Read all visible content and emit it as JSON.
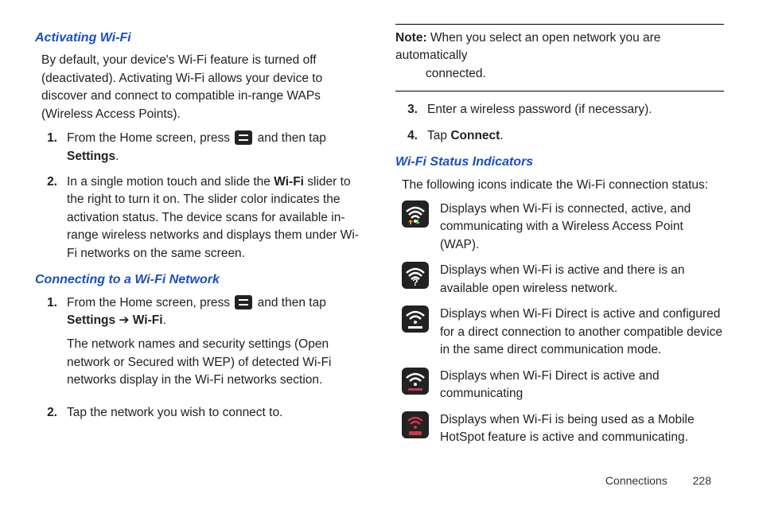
{
  "left": {
    "heading1": "Activating Wi-Fi",
    "intro1": "By default, your device's Wi-Fi feature is turned off (deactivated). Activating Wi-Fi allows your device to discover and connect to compatible in-range WAPs (Wireless Access Points).",
    "list1": {
      "item1_pre": "From the Home screen, press ",
      "item1_post": " and then tap ",
      "item1_bold": "Settings",
      "item1_end": ".",
      "item2_pre": "In a single motion touch and slide the ",
      "item2_bold": "Wi-Fi",
      "item2_post": " slider to the right to turn it on. The slider color indicates the activation status. The device scans for available in-range wireless networks and displays them under Wi-Fi networks on the same screen."
    },
    "heading2": "Connecting to a Wi-Fi Network",
    "list2": {
      "item1_pre": "From the Home screen, press ",
      "item1_post": " and then tap ",
      "item1_bold1": "Settings",
      "item1_arrow": " ➔ ",
      "item1_bold2": "Wi-Fi",
      "item1_end": ".",
      "item1_para2": "The network names and security settings (Open network or Secured with WEP) of detected Wi-Fi networks display in the Wi-Fi networks section.",
      "item2": "Tap the network you wish to connect to."
    }
  },
  "right": {
    "note_label": "Note:",
    "note_text": " When you select an open network you are automatically ",
    "note_text2": "connected.",
    "list3": {
      "item3": "Enter a wireless password (if necessary).",
      "item4_pre": "Tap ",
      "item4_bold": "Connect",
      "item4_end": "."
    },
    "heading3": "Wi-Fi Status Indicators",
    "intro3": "The following icons indicate the Wi-Fi connection status:",
    "status": [
      {
        "desc": " Displays when Wi-Fi is connected, active, and communicating with a Wireless Access Point (WAP)."
      },
      {
        "desc": "Displays when Wi-Fi is active and there is an available open wireless network."
      },
      {
        "desc": "Displays when Wi-Fi Direct is active and configured for a direct connection to another compatible device in the same direct communication mode."
      },
      {
        "desc": "Displays when Wi-Fi Direct is active and communicating"
      },
      {
        "desc": "Displays when Wi-Fi is being used as a Mobile HotSpot feature is active and communicating."
      }
    ]
  },
  "footer": {
    "label": "Connections",
    "page": "228"
  },
  "numbers": {
    "n1": "1.",
    "n2": "2.",
    "n3": "3.",
    "n4": "4."
  }
}
